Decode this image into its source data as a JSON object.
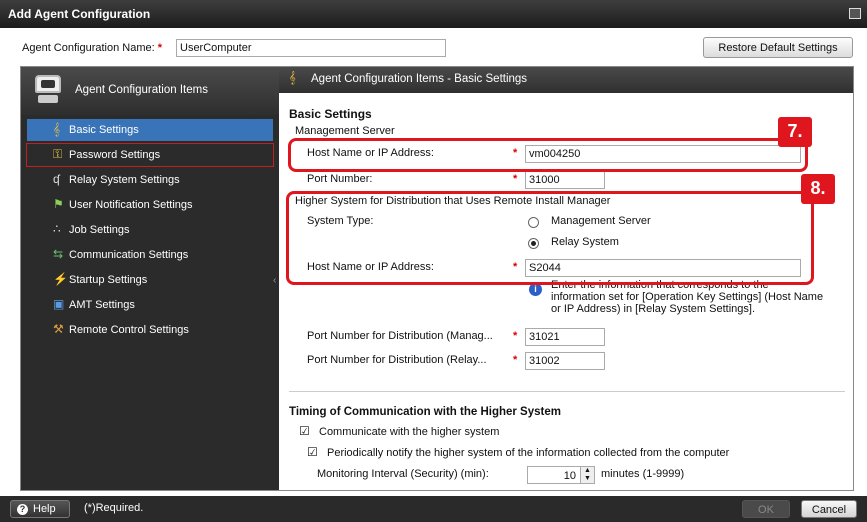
{
  "window": {
    "title": "Add Agent Configuration"
  },
  "config": {
    "name_label": "Agent Configuration Name:",
    "required_mark": "*",
    "name_value": "UserComputer",
    "restore_label": "Restore Default Settings"
  },
  "sidebar": {
    "header": "Agent Configuration Items",
    "items": [
      {
        "label": "Basic Settings",
        "icon": "basic-settings-icon"
      },
      {
        "label": "Password Settings",
        "icon": "password-icon"
      },
      {
        "label": "Relay System Settings",
        "icon": "relay-system-icon"
      },
      {
        "label": "User Notification Settings",
        "icon": "user-notification-icon"
      },
      {
        "label": "Job Settings",
        "icon": "job-icon"
      },
      {
        "label": "Communication Settings",
        "icon": "communication-icon"
      },
      {
        "label": "Startup Settings",
        "icon": "startup-icon"
      },
      {
        "label": "AMT Settings",
        "icon": "amt-icon"
      },
      {
        "label": "Remote Control Settings",
        "icon": "remote-control-icon"
      }
    ]
  },
  "main": {
    "header": "Agent Configuration Items - Basic Settings",
    "basic_title": "Basic Settings",
    "mgmt": {
      "section": "Management Server",
      "host_label": "Host Name or IP Address:",
      "host_value": "vm004250",
      "port_label": "Port Number:",
      "port_value": "31000"
    },
    "higher": {
      "section": "Higher System for Distribution that Uses Remote Install Manager",
      "system_type_label": "System Type:",
      "option_mgmt": "Management Server",
      "option_relay": "Relay System",
      "selected": "Relay System",
      "host_label": "Host Name or IP Address:",
      "host_value": "S2044",
      "info_line1": "Enter the information that corresponds to the",
      "info_line2": "information set for [Operation Key Settings] (Host Name",
      "info_line3": "or IP Address) in [Relay System Settings].",
      "port_mgmt_label": "Port Number for Distribution (Manag...",
      "port_mgmt_value": "31021",
      "port_relay_label": "Port Number for Distribution (Relay...",
      "port_relay_value": "31002"
    },
    "timing": {
      "title": "Timing of Communication with the Higher System",
      "communicate_label": "Communicate with the higher system",
      "communicate_checked": true,
      "notify_label": "Periodically notify the higher system of the information collected from the computer",
      "notify_checked": true,
      "interval_label": "Monitoring Interval (Security) (min):",
      "interval_value": "10",
      "interval_suffix": "minutes (1-9999)"
    }
  },
  "annotations": {
    "step7": "7.",
    "step8": "8.",
    "color": "#e0161f"
  },
  "footer": {
    "help": "Help",
    "required_note": "(*)Required.",
    "ok": "OK",
    "cancel": "Cancel"
  }
}
